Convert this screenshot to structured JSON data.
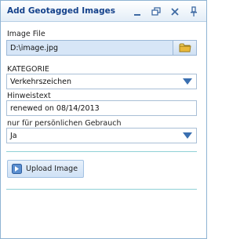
{
  "window": {
    "title": "Add Geotagged Images",
    "controls": [
      "minimize-icon",
      "restore-icon",
      "close-icon",
      "pin-icon"
    ]
  },
  "form": {
    "image_file": {
      "label": "Image File",
      "value": "D:\\image.jpg",
      "button_icon": "folder-icon"
    },
    "kategorie": {
      "label": "KATEGORIE",
      "value": "Verkehrszeichen"
    },
    "hinweistext": {
      "label": "Hinweistext",
      "value": "renewed on 08/14/2013"
    },
    "personal_use": {
      "label": "nur für persönlichen Gebrauch",
      "value": "Ja"
    },
    "upload_button": {
      "label": "Upload Image",
      "icon": "arrow-right-icon"
    }
  },
  "colors": {
    "title_text": "#15428b",
    "border": "#8fb3d3",
    "file_field_bg": "#d7e6f7",
    "dropdown_arrow": "#3a6fb0",
    "divider": "#8fd1d6"
  }
}
